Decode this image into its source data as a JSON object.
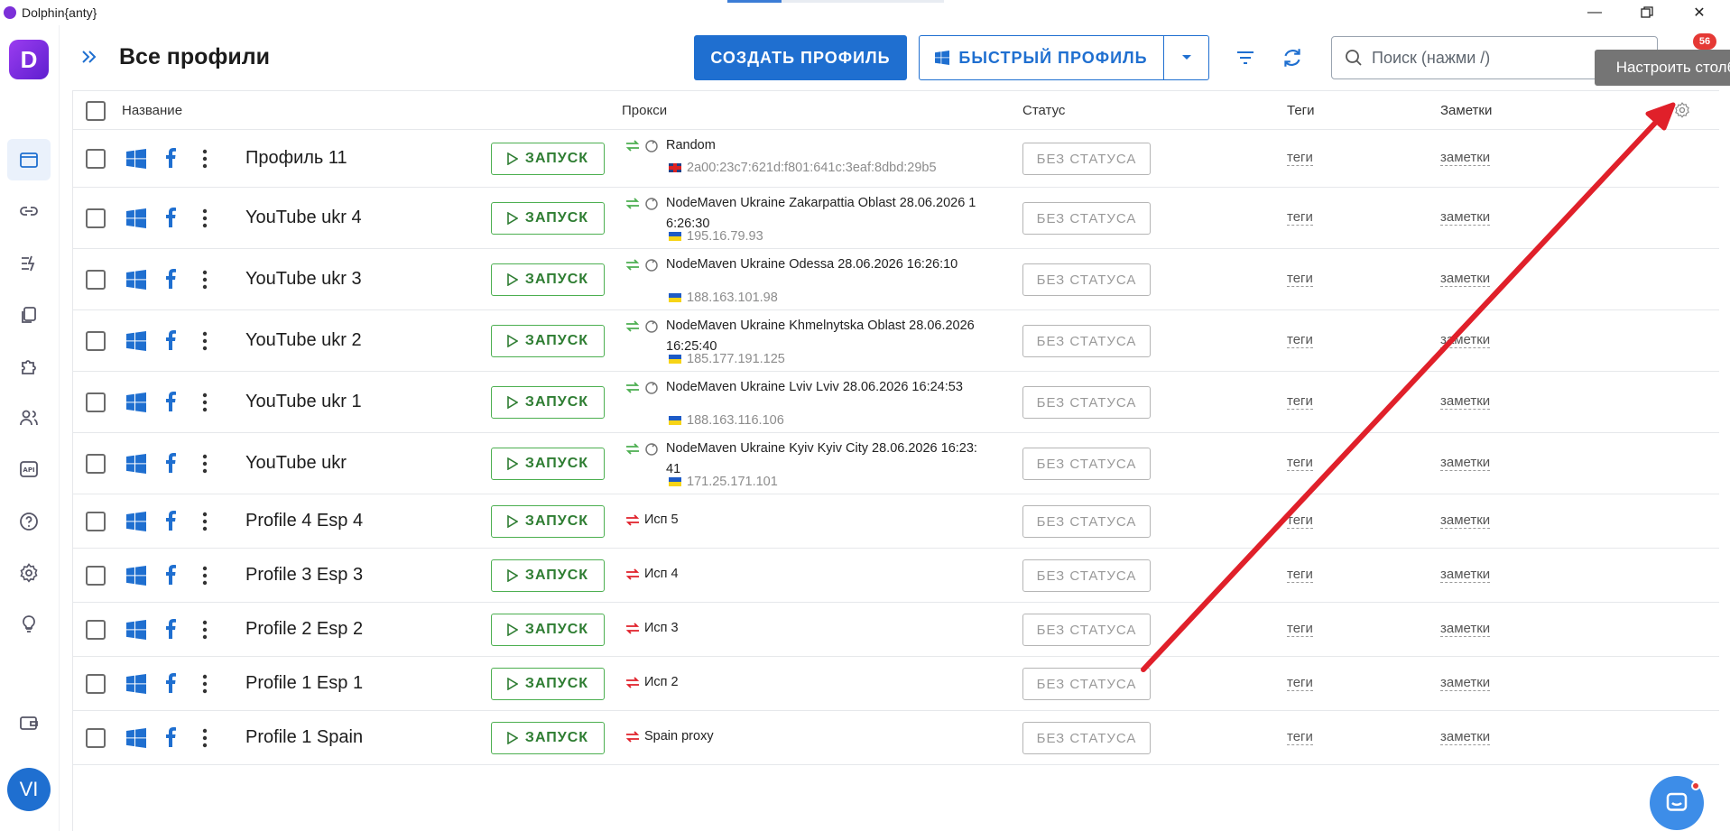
{
  "window": {
    "title": "Dolphin{anty}"
  },
  "header": {
    "title": "Все профили",
    "create_label": "СОЗДАТЬ ПРОФИЛЬ",
    "quick_label": "БЫСТРЫЙ ПРОФИЛЬ",
    "search_placeholder": "Поиск (нажми /)",
    "notifications_count": "56",
    "tooltip": "Настроить столбцы"
  },
  "sidebar": {
    "brand": "D",
    "avatar": "VI",
    "items": [
      "profiles",
      "link",
      "automation",
      "copy",
      "extensions",
      "users",
      "api",
      "help",
      "settings",
      "tips",
      "wallet"
    ]
  },
  "table": {
    "columns": {
      "name": "Название",
      "proxy": "Прокси",
      "status": "Статус",
      "tags": "Теги",
      "notes": "Заметки"
    },
    "launch_label": "ЗАПУСК",
    "status_label": "БЕЗ СТАТУСА",
    "tags_label": "теги",
    "notes_label": "заметки",
    "rows": [
      {
        "name": "Профиль 11",
        "proxy_line1": "Random",
        "proxy_line2": "",
        "proxy_ip": "2a00:23c7:621d:f801:641c:3eaf:8dbd:29b5",
        "flag": "uk",
        "proxy_type": "rotating"
      },
      {
        "name": "YouTube ukr 4",
        "proxy_line1": "NodeMaven Ukraine Zakarpattia Oblast 28.06.2026 1",
        "proxy_line2": "6:26:30",
        "proxy_ip": "195.16.79.93",
        "flag": "ua",
        "proxy_type": "rotating"
      },
      {
        "name": "YouTube ukr 3",
        "proxy_line1": "NodeMaven Ukraine Odessa 28.06.2026 16:26:10",
        "proxy_line2": "",
        "proxy_ip": "188.163.101.98",
        "flag": "ua",
        "proxy_type": "rotating"
      },
      {
        "name": "YouTube ukr 2",
        "proxy_line1": "NodeMaven Ukraine Khmelnytska Oblast 28.06.2026",
        "proxy_line2": "16:25:40",
        "proxy_ip": "185.177.191.125",
        "flag": "ua",
        "proxy_type": "rotating"
      },
      {
        "name": "YouTube ukr 1",
        "proxy_line1": "NodeMaven Ukraine Lviv Lviv 28.06.2026 16:24:53",
        "proxy_line2": "",
        "proxy_ip": "188.163.116.106",
        "flag": "ua",
        "proxy_type": "rotating"
      },
      {
        "name": "YouTube ukr",
        "proxy_line1": "NodeMaven Ukraine Kyiv Kyiv City 28.06.2026 16:23:",
        "proxy_line2": "41",
        "proxy_ip": "171.25.171.101",
        "flag": "ua",
        "proxy_type": "rotating"
      },
      {
        "name": "Profile 4 Esp 4",
        "proxy_line1": "Исп 5",
        "proxy_line2": "",
        "proxy_ip": "",
        "flag": "",
        "proxy_type": "static"
      },
      {
        "name": "Profile 3 Esp 3",
        "proxy_line1": "Исп 4",
        "proxy_line2": "",
        "proxy_ip": "",
        "flag": "",
        "proxy_type": "static"
      },
      {
        "name": "Profile 2 Esp 2",
        "proxy_line1": "Исп 3",
        "proxy_line2": "",
        "proxy_ip": "",
        "flag": "",
        "proxy_type": "static"
      },
      {
        "name": "Profile 1 Esp 1",
        "proxy_line1": "Исп 2",
        "proxy_line2": "",
        "proxy_ip": "",
        "flag": "",
        "proxy_type": "static"
      },
      {
        "name": "Profile 1 Spain",
        "proxy_line1": "Spain proxy",
        "proxy_line2": "",
        "proxy_ip": "",
        "flag": "",
        "proxy_type": "static"
      }
    ]
  },
  "colors": {
    "accent": "#1f6fd0",
    "launch_green": "#4caf50",
    "annotation_red": "#e0202a"
  }
}
